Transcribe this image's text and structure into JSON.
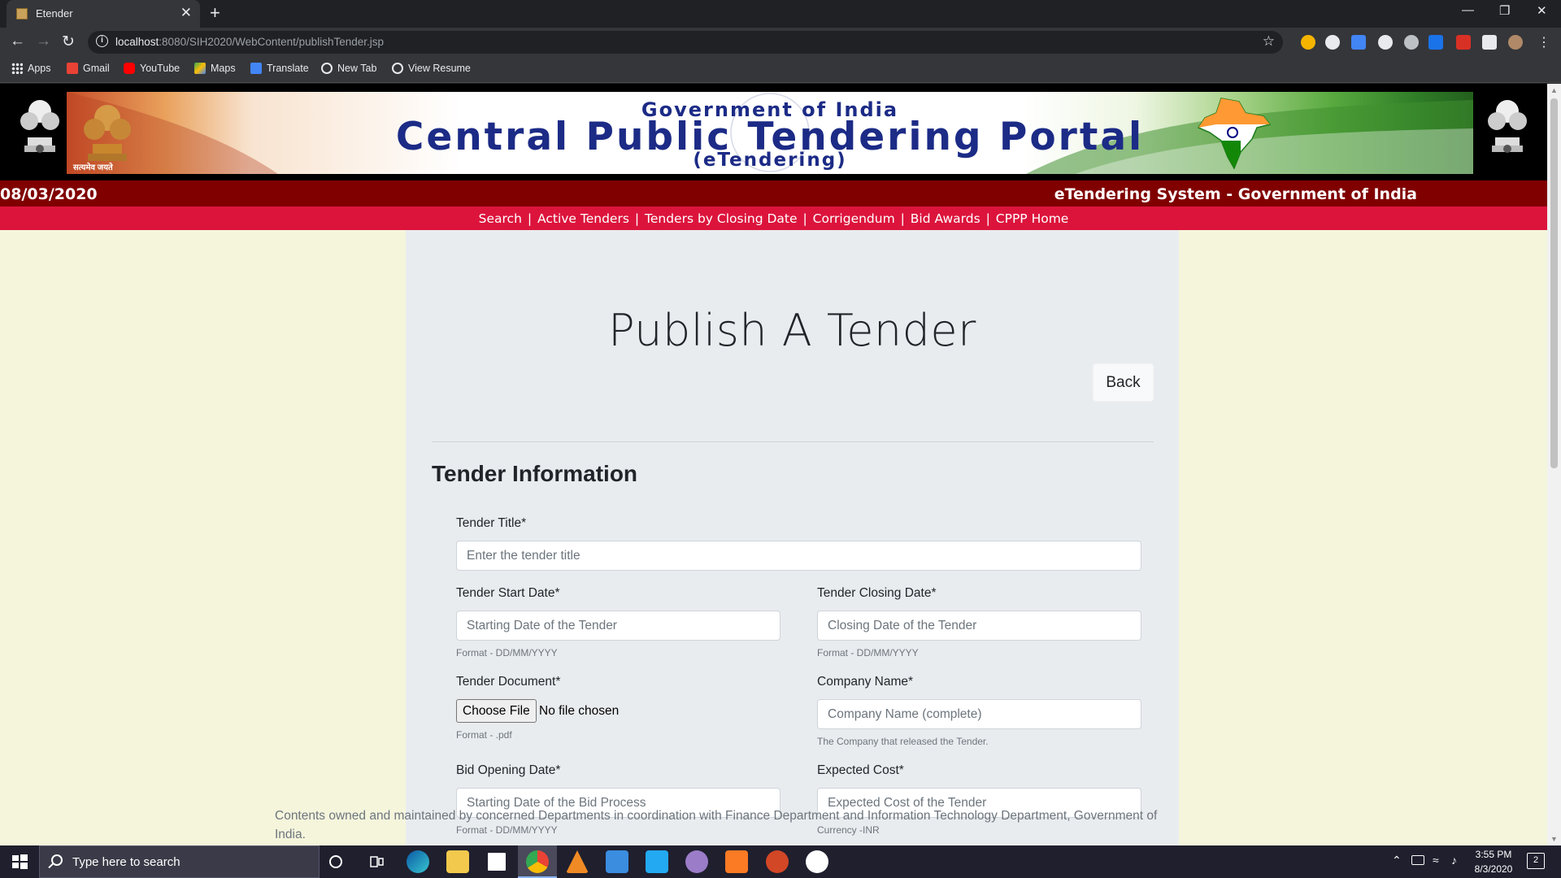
{
  "browser": {
    "tab_title": "Etender",
    "tab_close": "✕",
    "new_tab": "+",
    "url_host": "localhost",
    "url_path": ":8080/SIH2020/WebContent/publishTender.jsp",
    "window_controls": [
      "—",
      "❐",
      "✕"
    ],
    "bookmarks": [
      {
        "label": "Apps",
        "icon": "apps-grid-icon",
        "color": "#e8eaed"
      },
      {
        "label": "Gmail",
        "icon": "gmail-icon",
        "color": "#ea4335"
      },
      {
        "label": "YouTube",
        "icon": "youtube-icon",
        "color": "#ff0000"
      },
      {
        "label": "Maps",
        "icon": "maps-icon",
        "color": "#34a853"
      },
      {
        "label": "Translate",
        "icon": "translate-icon",
        "color": "#4285f4"
      },
      {
        "label": "New Tab",
        "icon": "globe-icon",
        "color": "#e8eaed"
      },
      {
        "label": "View Resume",
        "icon": "globe-icon",
        "color": "#e8eaed"
      }
    ]
  },
  "site": {
    "banner_line1": "Government of India",
    "banner_line2": "Central Public Tendering Portal",
    "banner_line3": "(eTendering)",
    "banner_motto": "सत्यमेव जयते",
    "date": "08/03/2020",
    "system_title": "eTendering System - Government of India",
    "nav_links": [
      "Search",
      "Active Tenders",
      "Tenders by Closing Date",
      "Corrigendum",
      "Bid Awards",
      "CPPP Home"
    ],
    "nav_separator": "|"
  },
  "page": {
    "title": "Publish A Tender",
    "back_label": "Back",
    "section_title": "Tender Information"
  },
  "form": {
    "tender_title": {
      "label": "Tender Title*",
      "placeholder": "Enter the tender title"
    },
    "start_date": {
      "label": "Tender Start Date*",
      "placeholder": "Starting Date of the Tender",
      "help": "Format - DD/MM/YYYY"
    },
    "closing_date": {
      "label": "Tender Closing Date*",
      "placeholder": "Closing Date of the Tender",
      "help": "Format - DD/MM/YYYY"
    },
    "document": {
      "label": "Tender Document*",
      "button": "Choose File",
      "status": "No file chosen",
      "help": "Format - .pdf"
    },
    "company": {
      "label": "Company Name*",
      "placeholder": "Company Name (complete)",
      "help": "The Company that released the Tender."
    },
    "bid_opening": {
      "label": "Bid Opening Date*",
      "placeholder": "Starting Date of the Bid Process",
      "help": "Format - DD/MM/YYYY"
    },
    "expected_cost": {
      "label": "Expected Cost*",
      "placeholder": "Expected Cost of the Tender",
      "help": "Currency -INR"
    }
  },
  "footer": {
    "text": "Contents owned and maintained by concerned Departments in coordination with Finance Department and Information Technology Department, Government of India."
  },
  "taskbar": {
    "search_placeholder": "Type here to search",
    "time": "3:55 PM",
    "date": "8/3/2020",
    "notification_count": "2"
  }
}
